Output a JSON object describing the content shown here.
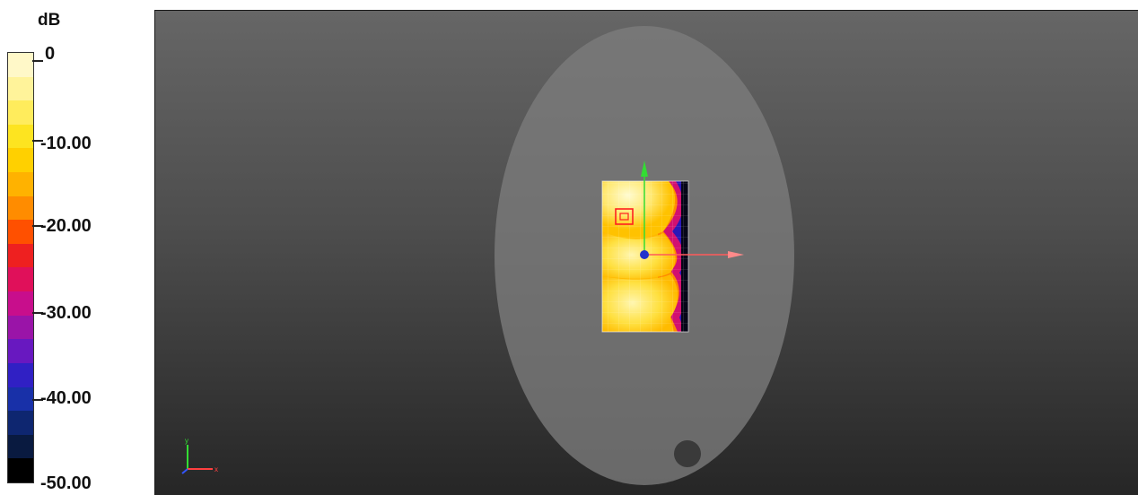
{
  "colorbar": {
    "unit": "dB",
    "ticks": [
      "0",
      "-10.00",
      "-20.00",
      "-30.00",
      "-40.00",
      "-50.00"
    ],
    "colors": [
      "#fff8c8",
      "#fff39a",
      "#ffec5c",
      "#fde420",
      "#ffd000",
      "#ffb200",
      "#ff8c00",
      "#ff5000",
      "#ee2020",
      "#e0105a",
      "#c80e8c",
      "#9a14a8",
      "#6818c0",
      "#3020c4",
      "#1830a8",
      "#0e2670",
      "#091a40",
      "#000000"
    ]
  },
  "viewport": {
    "axes": {
      "x_label": "x",
      "y_label": "y"
    },
    "colors": {
      "phantom": "#7c7c7c",
      "x_arrow": "#ff5a5a",
      "y_arrow": "#33dd33",
      "center_dot": "#2233cc",
      "marker": "#ff2020"
    }
  }
}
